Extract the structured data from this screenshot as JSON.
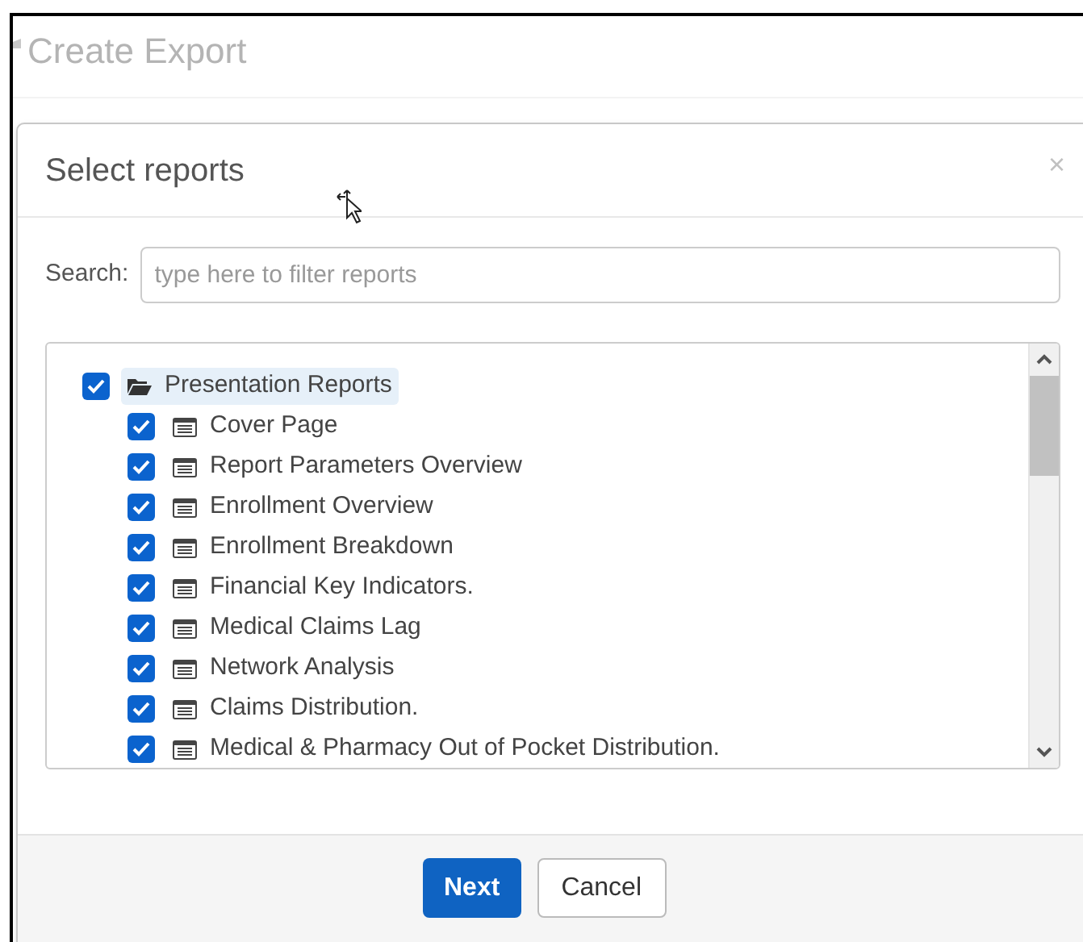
{
  "page": {
    "title": "Create Export"
  },
  "dialog": {
    "title": "Select reports",
    "close": "×"
  },
  "search": {
    "label": "Search:",
    "placeholder": "type here to filter reports"
  },
  "tree": [
    {
      "label": "Presentation Reports",
      "kind": "folder",
      "checked": true,
      "selected": true,
      "children": [
        {
          "label": "Cover Page",
          "kind": "report",
          "checked": true,
          "selected": false
        },
        {
          "label": "Report Parameters Overview",
          "kind": "report",
          "checked": true,
          "selected": false
        },
        {
          "label": "Enrollment Overview",
          "kind": "report",
          "checked": true,
          "selected": false
        },
        {
          "label": "Enrollment Breakdown",
          "kind": "report",
          "checked": true,
          "selected": false
        },
        {
          "label": "Financial Key Indicators.",
          "kind": "report",
          "checked": true,
          "selected": false
        },
        {
          "label": "Medical Claims Lag",
          "kind": "report",
          "checked": true,
          "selected": false
        },
        {
          "label": "Network Analysis",
          "kind": "report",
          "checked": true,
          "selected": false
        },
        {
          "label": "Claims Distribution.",
          "kind": "report",
          "checked": true,
          "selected": false
        },
        {
          "label": "Medical & Pharmacy Out of Pocket Distribution.",
          "kind": "report",
          "checked": true,
          "selected": false
        }
      ]
    }
  ],
  "buttons": [
    {
      "label": "Next",
      "kind": "primary"
    },
    {
      "label": "Cancel",
      "kind": "default"
    }
  ]
}
